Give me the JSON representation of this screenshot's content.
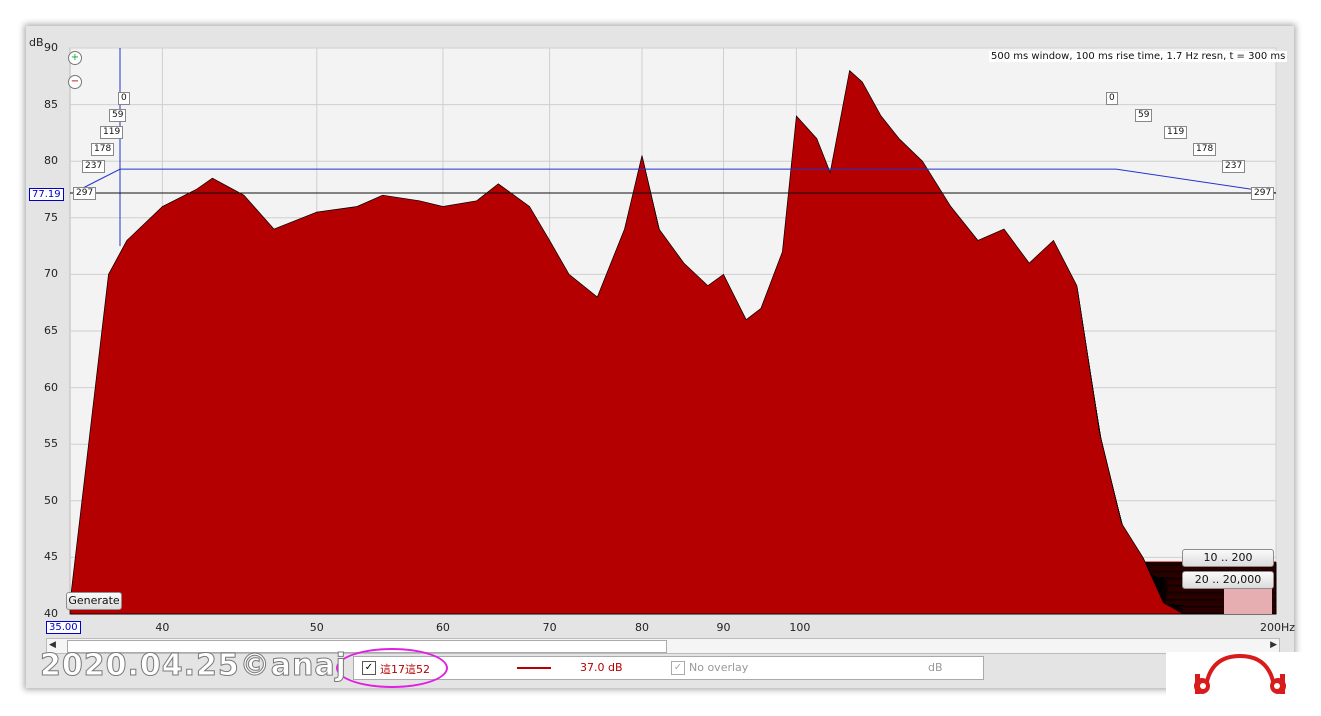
{
  "chart_data": {
    "type": "area",
    "title": "500 ms window, 100 ms rise time,  1.7 Hz resn, t = 300 ms",
    "ylabel": "dB",
    "xlabel": "",
    "y_ticks": [
      "90",
      "85",
      "80",
      "75",
      "70",
      "65",
      "60",
      "55",
      "50",
      "45",
      "40"
    ],
    "x_ticks": [
      "40",
      "50",
      "60",
      "70",
      "80",
      "90",
      "100",
      "200Hz"
    ],
    "ylim": [
      40,
      90
    ],
    "xlim": [
      35,
      200
    ],
    "x_scale": "log",
    "cursor_value": "77.19",
    "x_start": "35.00",
    "time_slices_ms": [
      "0",
      "59",
      "119",
      "178",
      "237",
      "297"
    ],
    "fill_color": "#b40000",
    "series": [
      {
        "x": [
          35,
          37,
          38,
          40,
          42,
          43,
          45,
          47,
          50,
          53,
          55,
          58,
          60,
          63,
          65,
          68,
          70,
          72,
          75,
          78,
          80,
          82,
          85,
          88,
          90,
          93,
          95,
          98,
          100,
          103,
          105,
          108,
          110,
          113,
          116,
          120,
          125,
          130,
          135,
          140,
          145,
          150,
          155,
          160,
          165,
          170,
          175,
          180,
          185,
          190,
          195,
          200
        ],
        "values": [
          41,
          70,
          73,
          76,
          77.5,
          78.5,
          77,
          74,
          75.5,
          76,
          77,
          76.5,
          76,
          76.5,
          78,
          76,
          73,
          70,
          68,
          74,
          80.5,
          74,
          71,
          69,
          70,
          66,
          67,
          72,
          84,
          82,
          79,
          88,
          87,
          84,
          82,
          80,
          76,
          73,
          74,
          71,
          73,
          69,
          56,
          48,
          45,
          41,
          40,
          40,
          40,
          40,
          40,
          40
        ]
      }
    ]
  },
  "buttons": {
    "generate": "Generate",
    "range1": "10 .. 200",
    "range2": "20 .. 20,000"
  },
  "legend": {
    "checkbox": "✓",
    "label": "這17這52",
    "value": "37.0 dB",
    "overlay": "No overlay",
    "unit": "dB",
    "line_color": "#b40000"
  },
  "watermark": "2020.04.25©anaj"
}
